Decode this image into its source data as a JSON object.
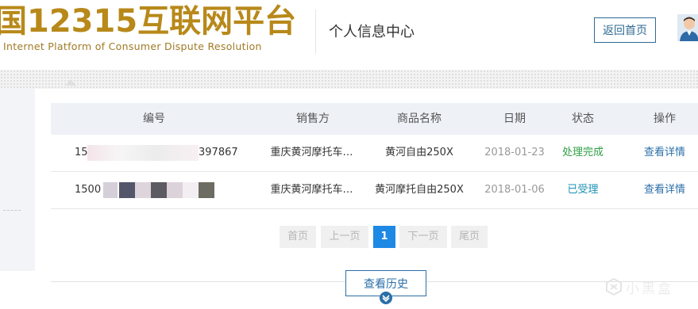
{
  "header": {
    "logo_main": "国12315互联网平台",
    "logo_sub": "Internet Platform of Consumer Dispute Resolution",
    "title": "个人信息中心",
    "back_label": "返回首页"
  },
  "table": {
    "columns": [
      "编号",
      "销售方",
      "商品名称",
      "日期",
      "状态",
      "操作"
    ],
    "rows": [
      {
        "id_start": "15",
        "id_end": "397867",
        "seller": "重庆黄河摩托车…",
        "product": "黄河自由250X",
        "date": "2018-01-23",
        "status": "处理完成",
        "action": "查看详情"
      },
      {
        "id_start": "1500",
        "id_end": "",
        "seller": "重庆黄河摩托车…",
        "product": "黄河摩托自由250X",
        "date": "2018-01-06",
        "status": "已受理",
        "action": "查看详情"
      }
    ]
  },
  "pagination": {
    "first": "首页",
    "prev": "上一页",
    "current": "1",
    "next": "下一页",
    "last": "尾页"
  },
  "history": {
    "label": "查看历史"
  },
  "watermark": {
    "text": "小黑盒"
  },
  "colors": {
    "brand_gold": "#b8891a",
    "link_blue": "#2b6fa8",
    "status_done": "#2fa046",
    "status_accepted": "#1a8fb4",
    "active_page": "#1e88e5"
  }
}
